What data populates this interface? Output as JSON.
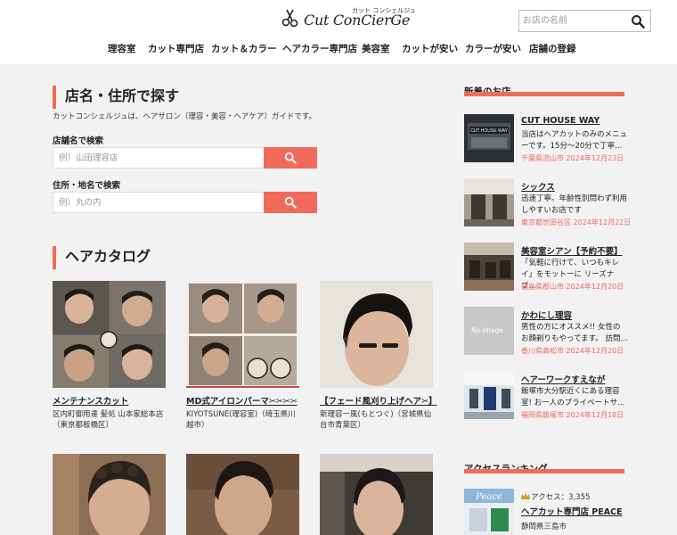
{
  "header": {
    "logo_text": "Cut ConCierGe",
    "logo_sub": "カット コンシェルジュ",
    "search_placeholder": "お店の名前"
  },
  "nav": [
    "理容室",
    "カット専門店",
    "カット＆カラー",
    "ヘアカラー専門店",
    "美容室",
    "カットが安い",
    "カラーが安い",
    "店舗の登録"
  ],
  "search_section": {
    "title": "店名・住所で探す",
    "desc": "カットコンシェルジュは、ヘアサロン（理容・美容・ヘアケア）ガイドです。",
    "shop_label": "店舗名で検索",
    "shop_placeholder": "例）山田理容店",
    "address_label": "住所・地名で検索",
    "address_placeholder": "例）丸の内"
  },
  "catalog": {
    "title": "ヘアカタログ",
    "items": [
      {
        "title": "メンテナンスカット",
        "shop": "区内町御用達 髪処 山本家総本店（東京都板橋区）"
      },
      {
        "title": "MD式アイロンパーマ✂✂✂✂",
        "shop": "KIYOTSUNE(理容室)（埼玉県川越市）"
      },
      {
        "title": "【フェード風刈り上げヘア✂】",
        "shop": "新理容一風(もとつぐ)（宮城県仙台市青葉区）"
      },
      {
        "title": "",
        "shop": ""
      },
      {
        "title": "",
        "shop": ""
      },
      {
        "title": "",
        "shop": ""
      }
    ]
  },
  "sidebar": {
    "new_title": "新着のお店",
    "news": [
      {
        "title": "CUT HOUSE WAY",
        "text": "当店はヘアカットのみのメニューです。15分〜20分で丁寧...",
        "meta": "千葉県流山市 2024年12月23日",
        "thumb": "CUT HOUSE WAY"
      },
      {
        "title": "シックス",
        "text": "迅速丁寧。年齢性別問わず利用しやすいお店です",
        "meta": "東京都世田谷区 2024年12月22日",
        "thumb": ""
      },
      {
        "title": "美容室シアン【予約不要】",
        "text": "「気軽に行けて、いつもキレイ」をモットーに リーズナブ...",
        "meta": "福島県郡山市 2024年12月20日",
        "thumb": ""
      },
      {
        "title": "かわにし理容",
        "text": "男性の方にオススメ!! 女性のお顔剃りもやってます。 訪問...",
        "meta": "香川県高松市 2024年12月20日",
        "thumb": "No image"
      },
      {
        "title": "ヘアーワークすえなが",
        "text": "飯塚市大分駅近くにある理容室! お一人のプライベートサ...",
        "meta": "福岡県飯塚市 2024年12月18日",
        "thumb": ""
      }
    ],
    "ranking_title": "アクセスランキング",
    "ranking": [
      {
        "access": "アクセス：3,355",
        "name": "ヘアカット専門店 PEACE",
        "area": "静岡県三島市",
        "thumb": "Peace"
      }
    ]
  }
}
